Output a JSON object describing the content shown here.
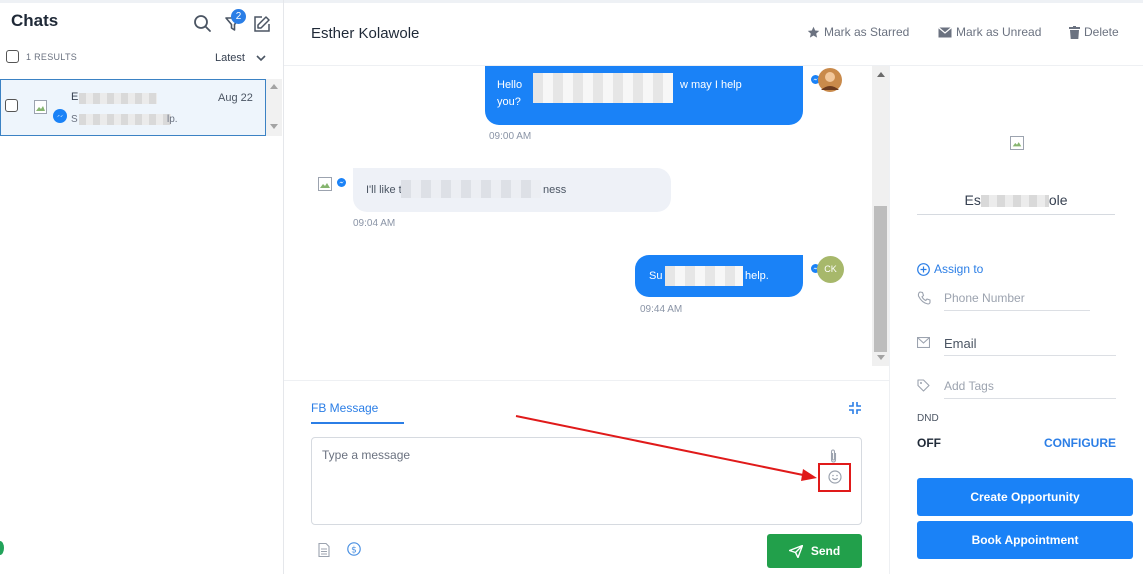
{
  "left": {
    "title": "Chats",
    "filter_badge": "2",
    "results": "1 RESULTS",
    "sort": "Latest",
    "chat_item": {
      "name": "E",
      "date": "Aug 22",
      "preview": "S",
      "preview_end": "lp."
    }
  },
  "header": {
    "contact_name": "Esther Kolawole",
    "actions": {
      "starred": "Mark as Starred",
      "unread": "Mark as Unread",
      "delete": "Delete"
    }
  },
  "messages": [
    {
      "direction": "out",
      "text_start": "Hello",
      "text_mid": "w may I help",
      "text_line2": "you?",
      "time": "09:00 AM"
    },
    {
      "direction": "in",
      "text_start": "I'll like t",
      "text_end": "ness",
      "time": "09:04 AM"
    },
    {
      "direction": "out",
      "text_start": "Su",
      "text_end": "help.",
      "time": "09:44 AM",
      "avatar_initials": "CK"
    }
  ],
  "composer": {
    "tab": "FB Message",
    "placeholder": "Type a message",
    "send_label": "Send"
  },
  "right": {
    "name_start": "Es",
    "name_end": "ole",
    "assign": "Assign to",
    "phone_placeholder": "Phone Number",
    "email_label": "Email",
    "tags_placeholder": "Add Tags",
    "dnd_label": "DND",
    "dnd_value": "OFF",
    "configure": "CONFIGURE",
    "create_opportunity": "Create Opportunity",
    "book_appointment": "Book Appointment"
  },
  "colors": {
    "accent": "#1a82f7",
    "send": "#22a04b",
    "annotation": "#e01a1a"
  }
}
